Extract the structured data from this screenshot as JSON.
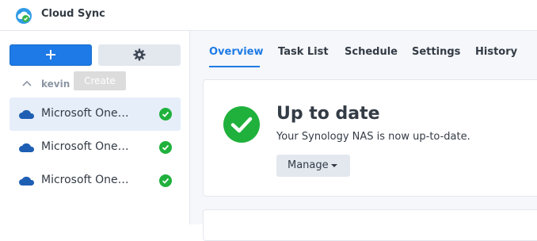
{
  "app": {
    "title": "Cloud Sync"
  },
  "sidebar": {
    "tooltip": "Create",
    "group_name": "kevin",
    "tasks": [
      {
        "label": "Microsoft One…",
        "status": "ok"
      },
      {
        "label": "Microsoft One…",
        "status": "ok"
      },
      {
        "label": "Microsoft One…",
        "status": "ok"
      }
    ]
  },
  "tabs": [
    "Overview",
    "Task List",
    "Schedule",
    "Settings",
    "History"
  ],
  "overview": {
    "status_title": "Up to date",
    "status_desc": "Your Synology NAS is now up-to-date.",
    "manage_label": "Manage"
  },
  "colors": {
    "accent": "#1e7ae6",
    "success": "#1fb13c",
    "onedrive": "#1e5fb4"
  }
}
